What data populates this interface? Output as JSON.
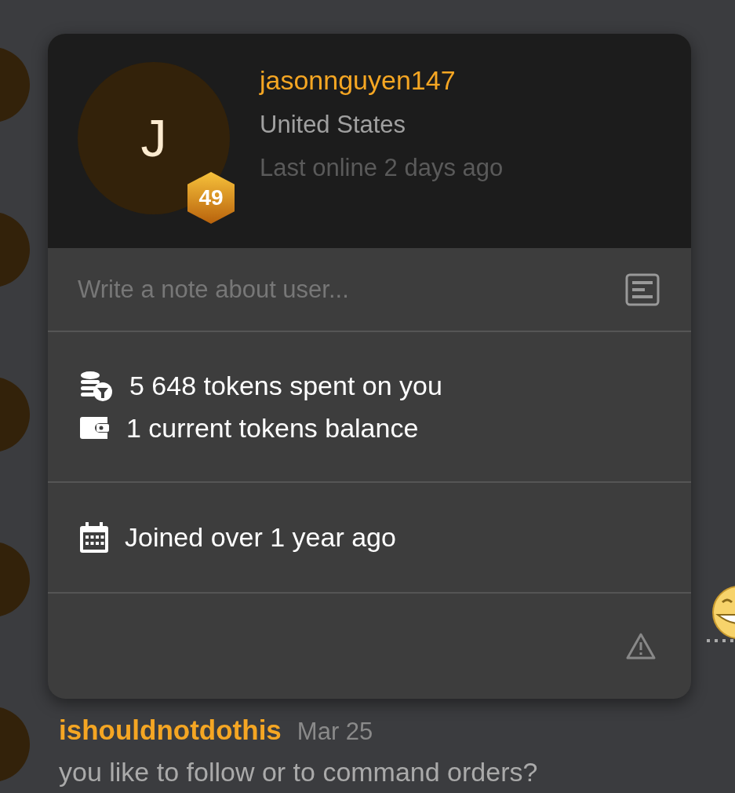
{
  "profile": {
    "initial": "J",
    "level": "49",
    "username": "jasonnguyen147",
    "country": "United States",
    "last_online": "Last online 2 days ago"
  },
  "note": {
    "placeholder": "Write a note about user..."
  },
  "stats": [
    {
      "kind": "spent",
      "text": "5 648 tokens spent on you"
    },
    {
      "kind": "balance",
      "text": "1 current tokens balance"
    }
  ],
  "joined": {
    "kind": "calendar",
    "text": "Joined over 1 year ago"
  },
  "message": {
    "author": "ishouldnotdothis",
    "date": "Mar 25",
    "text": "you like to follow or to command orders?"
  }
}
